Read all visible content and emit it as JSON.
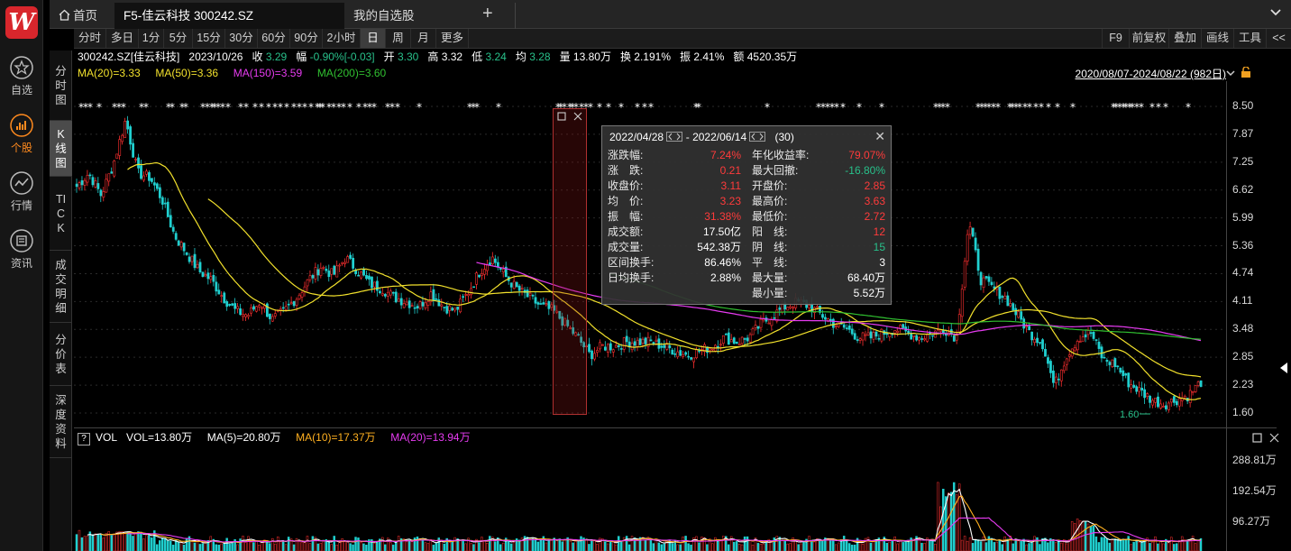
{
  "rail": {
    "items": [
      {
        "label": "自选",
        "icon": "star-icon"
      },
      {
        "label": "个股",
        "icon": "stock-chart-icon"
      },
      {
        "label": "行情",
        "icon": "market-trend-icon"
      },
      {
        "label": "资讯",
        "icon": "news-icon"
      }
    ]
  },
  "tabs": {
    "home": "首页",
    "stock": "F5-佳云科技 300242.SZ",
    "watchlist": "我的自选股",
    "add": "+"
  },
  "vtabs": [
    "分时图",
    "K线图",
    "TICK",
    "成交明细",
    "分价表",
    "深度资料"
  ],
  "periods": [
    "分时",
    "多日",
    "1分",
    "5分",
    "15分",
    "30分",
    "60分",
    "90分",
    "2小时",
    "日",
    "周",
    "月",
    "更多"
  ],
  "active_period": "日",
  "tools": [
    "F9",
    "前复权",
    "叠加",
    "画线",
    "工具",
    "<<"
  ],
  "info": {
    "code": "300242.SZ[佳云科技]",
    "date": "2023/10/26",
    "close_label": "收",
    "close": "3.29",
    "change_label": "幅",
    "change": "-0.90%[-0.03]",
    "open_label": "开",
    "open": "3.30",
    "high_label": "高",
    "high": "3.32",
    "low_label": "低",
    "low": "3.24",
    "avg_label": "均",
    "avg": "3.28",
    "volume": "量 13.80万",
    "turnover": "换 2.191%",
    "amplitude": "振 2.41%",
    "amount": "额 4520.35万"
  },
  "ma": {
    "ma20": "MA(20)=3.33",
    "ma50": "MA(50)=3.36",
    "ma150": "MA(150)=3.59",
    "ma200": "MA(200)=3.60"
  },
  "date_range": "2020/08/07-2024/08/22 (982日)",
  "low_marker": "1.60",
  "vol_legend": {
    "help": "?",
    "label": "VOL",
    "vol": "VOL=13.80万",
    "ma5": "MA(5)=20.80万",
    "ma10": "MA(10)=17.37万",
    "ma20": "MA(20)=13.94万"
  },
  "popup": {
    "from": "2022/04/28",
    "to": "- 2022/06/14",
    "count": "(30)",
    "left": [
      {
        "label": "涨跌幅:",
        "value": "7.24%",
        "color": "#ff3b3b"
      },
      {
        "label": "涨　跌:",
        "value": "0.21",
        "color": "#ff3b3b"
      },
      {
        "label": "收盘价:",
        "value": "3.11",
        "color": "#ff3b3b"
      },
      {
        "label": "均　价:",
        "value": "3.23",
        "color": "#ff3b3b"
      },
      {
        "label": "振　幅:",
        "value": "31.38%",
        "color": "#ff3b3b"
      },
      {
        "label": "成交额:",
        "value": "17.50亿",
        "color": "#ffffff"
      },
      {
        "label": "成交量:",
        "value": "542.38万",
        "color": "#ffffff"
      },
      {
        "label": "区间换手:",
        "value": "86.46%",
        "color": "#ffffff"
      },
      {
        "label": "日均换手:",
        "value": "2.88%",
        "color": "#ffffff"
      }
    ],
    "right": [
      {
        "label": "年化收益率:",
        "value": "79.07%",
        "color": "#ff3b3b"
      },
      {
        "label": "最大回撤:",
        "value": "-16.80%",
        "color": "#28c08a"
      },
      {
        "label": "开盘价:",
        "value": "2.85",
        "color": "#ff3b3b"
      },
      {
        "label": "最高价:",
        "value": "3.63",
        "color": "#ff3b3b"
      },
      {
        "label": "最低价:",
        "value": "2.72",
        "color": "#ff3b3b"
      },
      {
        "label": "阳　线:",
        "value": "12",
        "color": "#ff3b3b"
      },
      {
        "label": "阴　线:",
        "value": "15",
        "color": "#28c08a"
      },
      {
        "label": "平　线:",
        "value": "3",
        "color": "#ffffff"
      },
      {
        "label": "最大量:",
        "value": "68.40万",
        "color": "#ffffff"
      },
      {
        "label": "最小量:",
        "value": "5.52万",
        "color": "#ffffff"
      }
    ]
  },
  "chart_data": {
    "type": "candlestick",
    "y_ticks": [
      "8.50",
      "7.87",
      "7.25",
      "6.62",
      "5.99",
      "5.36",
      "4.74",
      "4.11",
      "3.48",
      "2.85",
      "2.23",
      "1.60"
    ],
    "ylim": [
      1.6,
      8.5
    ],
    "vol_ticks": [
      "288.81万",
      "192.54万",
      "96.27万"
    ],
    "vol_max_wan": 300,
    "close_path": [
      6.7,
      7.0,
      6.5,
      7.2,
      8.2,
      7.0,
      6.9,
      6.4,
      5.6,
      5.2,
      4.8,
      4.6,
      4.2,
      3.9,
      3.8,
      4.1,
      3.7,
      3.9,
      4.2,
      4.6,
      4.9,
      4.7,
      5.1,
      4.8,
      4.5,
      4.4,
      4.2,
      4.1,
      4.0,
      4.3,
      4.0,
      3.9,
      4.3,
      4.8,
      5.1,
      4.7,
      4.4,
      4.2,
      4.0,
      3.9,
      3.6,
      3.3,
      2.9,
      3.1,
      3.1,
      3.2,
      3.2,
      3.2,
      3.1,
      3.0,
      2.9,
      3.0,
      3.1,
      3.3,
      3.2,
      3.3,
      3.6,
      3.8,
      4.0,
      4.1,
      4.0,
      3.8,
      3.6,
      3.5,
      3.3,
      3.3,
      3.4,
      3.5,
      3.4,
      3.3,
      3.4,
      3.5,
      3.3,
      5.9,
      4.6,
      4.4,
      4.2,
      3.8,
      3.4,
      3.2,
      2.2,
      2.9,
      3.3,
      3.4,
      2.8,
      2.7,
      2.3,
      2.1,
      1.9,
      1.8,
      1.9,
      2.0,
      2.3
    ]
  }
}
